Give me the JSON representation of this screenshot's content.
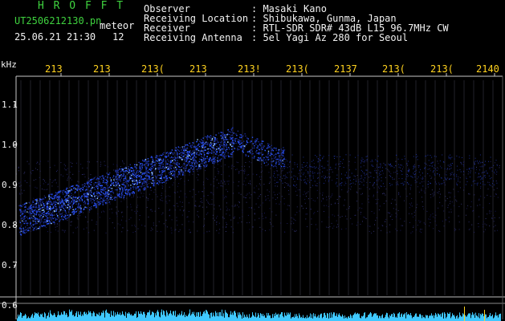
{
  "header": {
    "app_name": "H R O F F T",
    "file_name": "UT2506212130.pn",
    "file_tag": "meteor",
    "date_time": "25.06.21 21:30",
    "count": "12",
    "fields": [
      {
        "label": "Observer",
        "value": ": Masaki Kano"
      },
      {
        "label": "Receiving Location",
        "value": ": Shibukawa, Gunma, Japan"
      },
      {
        "label": "Receiver",
        "value": ": RTL-SDR SDR# 43dB L15 96.7MHz CW"
      },
      {
        "label": "Receiving Antenna",
        "value": ": 5el Yagi Az 280 for Seoul"
      }
    ]
  },
  "y_axis": {
    "unit": "kHz",
    "ticks": [
      "1.1",
      "1.0",
      "0.9",
      "0.8",
      "0.7",
      "0.6"
    ]
  },
  "x_axis": {
    "ticks": [
      "213",
      "213",
      "213(",
      "213",
      "213!",
      "213(",
      "2137",
      "213(",
      "213(",
      "2140"
    ]
  },
  "colors": {
    "background": "#000000",
    "header_title": "#3fd23f",
    "header_text": "#f2f2f2",
    "tick_x": "#ffd21f",
    "axis_line": "#c8c8c8",
    "grid": "#22222a",
    "echo": "#2b55ff",
    "echo_bright": "#9fd0ff",
    "spectrum": "#3fc8ff"
  }
}
